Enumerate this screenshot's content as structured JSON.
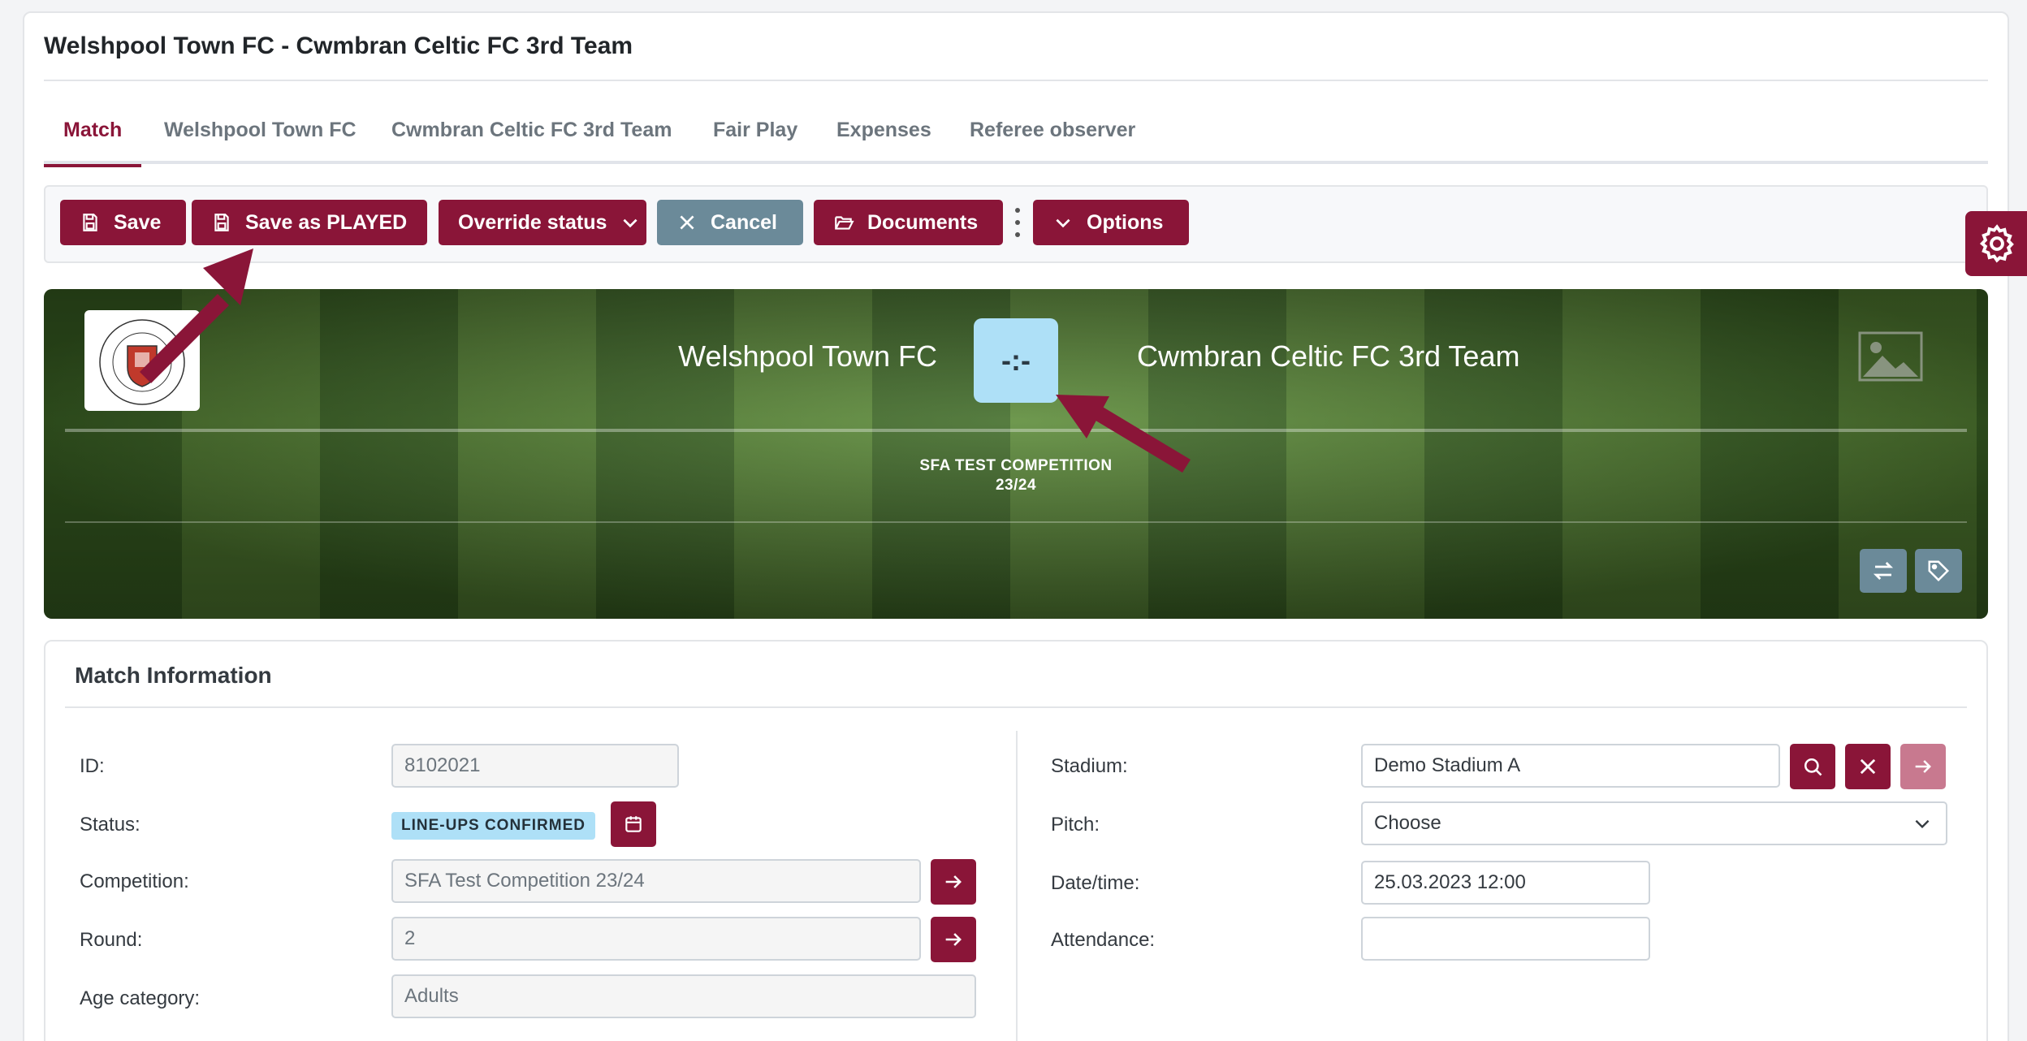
{
  "page": {
    "title": "Welshpool Town FC - Cwmbran Celtic FC 3rd Team"
  },
  "tabs": [
    {
      "label": "Match",
      "active": true
    },
    {
      "label": "Welshpool Town FC"
    },
    {
      "label": "Cwmbran Celtic FC 3rd Team"
    },
    {
      "label": "Fair Play"
    },
    {
      "label": "Expenses"
    },
    {
      "label": "Referee observer"
    }
  ],
  "toolbar": {
    "save": "Save",
    "save_played": "Save as PLAYED",
    "override_status": "Override status",
    "cancel": "Cancel",
    "documents": "Documents",
    "options": "Options"
  },
  "banner": {
    "home_team": "Welshpool Town FC",
    "away_team": "Cwmbran Celtic FC 3rd Team",
    "score": "-:-",
    "competition_line1": "SFA TEST COMPETITION",
    "competition_line2": "23/24",
    "logo_text_top": "WELSHPOOL TOWN",
    "logo_text_bottom": "FOOTBALL CLUB"
  },
  "match_info": {
    "title": "Match Information",
    "id_label": "ID:",
    "id_value": "8102021",
    "status_label": "Status:",
    "status_value": "LINE-UPS CONFIRMED",
    "competition_label": "Competition:",
    "competition_value": "SFA Test Competition 23/24",
    "round_label": "Round:",
    "round_value": "2",
    "age_label": "Age category:",
    "age_value": "Adults",
    "stadium_label": "Stadium:",
    "stadium_value": "Demo Stadium A",
    "pitch_label": "Pitch:",
    "pitch_value": "Choose",
    "datetime_label": "Date/time:",
    "datetime_value": "25.03.2023 12:00",
    "attendance_label": "Attendance:",
    "attendance_value": ""
  },
  "colors": {
    "brand": "#8a1538",
    "secondary": "#6b8a99",
    "badge": "#aee0f7"
  }
}
